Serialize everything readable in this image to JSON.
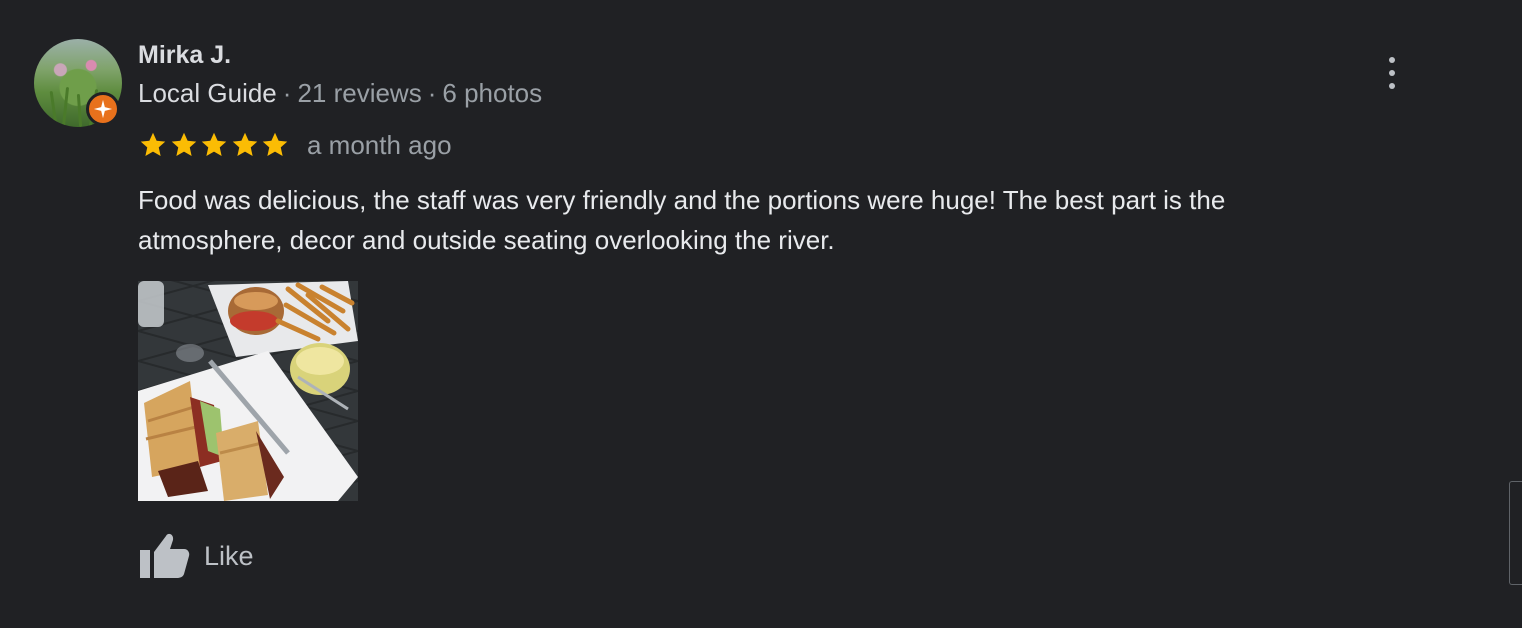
{
  "review": {
    "author_name": "Mirka J.",
    "author_badge": "Local Guide",
    "review_count": "21 reviews",
    "photo_count": "6 photos",
    "separator": "·",
    "rating": 5,
    "rating_max": 5,
    "date": "a month ago",
    "text": "Food was delicious, the staff was very friendly and the portions were huge! The best part is the atmosphere, decor and outside seating overlooking the river.",
    "like_label": "Like"
  },
  "icons": {
    "menu": "more-vert-icon",
    "like": "thumbs-up-icon",
    "badge": "local-guide-badge-icon",
    "star": "star-icon"
  },
  "colors": {
    "background": "#202124",
    "star": "#fbbc04",
    "badge": "#e8711c",
    "secondary_text": "#9aa0a6",
    "primary_text": "#e8eaed"
  }
}
